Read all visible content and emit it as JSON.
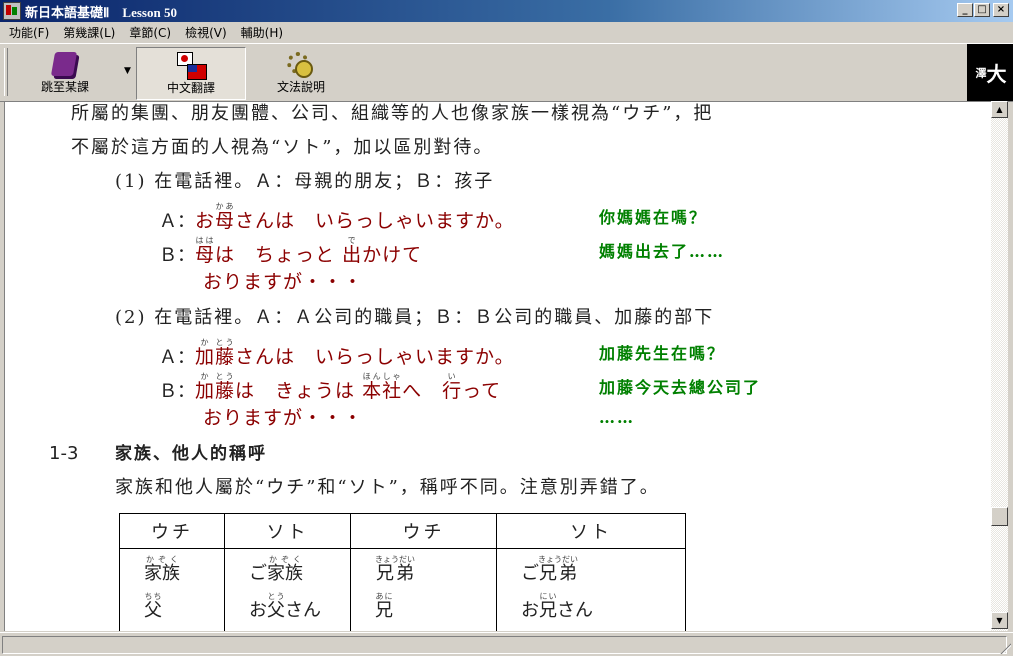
{
  "window": {
    "title": "新日本語基礎Ⅱ　Lesson 50"
  },
  "menu": [
    "功能(F)",
    "第幾課(L)",
    "章節(C)",
    "檢視(V)",
    "輔助(H)"
  ],
  "toolbar": {
    "jump": "跳至某課",
    "translate": "中文翻譯",
    "grammar": "文法說明",
    "logo_small": "澤",
    "logo_big": "大"
  },
  "content": {
    "intro1": "所屬的集團、朋友團體、公司、組織等的人也像家族一樣視為“ウチ”，把",
    "intro2": "不屬於這方面的人視為“ソト”，加以區別對待。",
    "ex1": {
      "title": "(1) 在電話裡。Ａ：母親的朋友；Ｂ：孩子",
      "a_label": "Ａ：",
      "a_pre": "お",
      "a_k1": "母",
      "a_r1": "かあ",
      "a_post": "さんは　いらっしゃいますか。",
      "a_zh": "你媽媽在嗎？",
      "b_label": "Ｂ：",
      "b_k1": "母",
      "b_r1": "はは",
      "b_mid": "は　ちょっと ",
      "b_k2": "出",
      "b_r2": "で",
      "b_post": "かけて",
      "b_zh": "媽媽出去了……",
      "b_cont": "おりますが・・・"
    },
    "ex2": {
      "title": "(2) 在電話裡。Ａ：Ａ公司的職員；Ｂ：Ｂ公司的職員、加藤的部下",
      "a_label": "Ａ：",
      "a_k1": "加",
      "a_r1": "か",
      "a_k2": "藤",
      "a_r2": "とう",
      "a_post": "さんは　いらっしゃいますか。",
      "a_zh": "加藤先生在嗎？",
      "b_label": "Ｂ：",
      "b_k1": "加",
      "b_r1": "か",
      "b_k2": "藤",
      "b_r2": "とう",
      "b_mid": "は　きょうは ",
      "b_k3": "本社",
      "b_r3": "ほんしゃ",
      "b_mid2": "へ　",
      "b_k4": "行",
      "b_r4": "い",
      "b_post": "って",
      "b_zh": "加藤今天去總公司了",
      "b_cont": "おりますが・・・",
      "b_zh_cont": "……"
    },
    "section_num": "1-3",
    "section_title": "家族、他人的稱呼",
    "section_desc": "家族和他人屬於“ウチ”和“ソト”，稱呼不同。注意別弄錯了。",
    "table": {
      "headers": [
        "ウチ",
        "ソト",
        "ウチ",
        "ソト"
      ],
      "row1": [
        {
          "pre": "",
          "kanji": "家族",
          "ruby": "かぞく",
          "post": ""
        },
        {
          "pre": "ご",
          "kanji": "家族",
          "ruby": "かぞく",
          "post": ""
        },
        {
          "pre": "",
          "kanji": "兄弟",
          "ruby": "きょうだい",
          "post": ""
        },
        {
          "pre": "ご",
          "kanji": "兄弟",
          "ruby": "きょうだい",
          "post": ""
        }
      ],
      "row2": [
        {
          "pre": "",
          "kanji": "父",
          "ruby": "ちち",
          "post": ""
        },
        {
          "pre": "お",
          "kanji": "父",
          "ruby": "とう",
          "post": "さん"
        },
        {
          "pre": "",
          "kanji": "兄",
          "ruby": "あに",
          "post": ""
        },
        {
          "pre": "お",
          "kanji": "兄",
          "ruby": "にい",
          "post": "さん"
        }
      ]
    }
  },
  "colors": {
    "japanese": "#8b0000",
    "translation": "#008000",
    "title_bar": "#0a246a"
  }
}
